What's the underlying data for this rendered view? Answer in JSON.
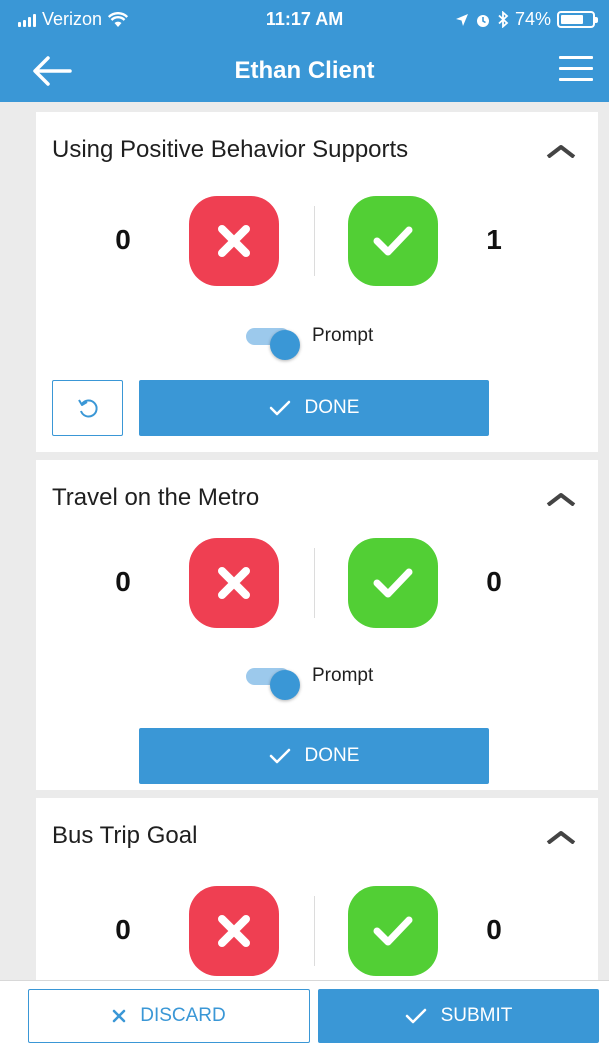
{
  "status_bar": {
    "carrier": "Verizon",
    "time": "11:17 AM",
    "battery_percent": "74%",
    "battery_level": 0.74,
    "icons": [
      "signal-icon",
      "wifi-icon",
      "location-icon",
      "alarm-icon",
      "bluetooth-icon",
      "battery-icon"
    ]
  },
  "nav": {
    "title": "Ethan Client",
    "back_icon": "back-arrow-icon",
    "menu_icon": "hamburger-menu-icon"
  },
  "goals": [
    {
      "title": "Using Positive Behavior Supports",
      "fail_count": "0",
      "pass_count": "1",
      "prompt_label": "Prompt",
      "prompt_on": true,
      "done_label": "DONE",
      "has_undo": true
    },
    {
      "title": "Travel on the Metro",
      "fail_count": "0",
      "pass_count": "0",
      "prompt_label": "Prompt",
      "prompt_on": true,
      "done_label": "DONE",
      "has_undo": false
    },
    {
      "title": "Bus Trip Goal",
      "fail_count": "0",
      "pass_count": "0"
    }
  ],
  "footer": {
    "discard_label": "DISCARD",
    "submit_label": "SUBMIT"
  },
  "colors": {
    "primary": "#3a97d6",
    "fail": "#ef3f52",
    "pass": "#52cf35"
  }
}
